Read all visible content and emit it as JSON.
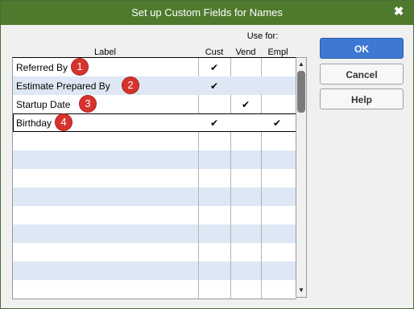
{
  "window": {
    "title": "Set up Custom Fields for Names",
    "close_glyph": "✖"
  },
  "table": {
    "use_for_label": "Use for:",
    "columns": [
      "Label",
      "Cust",
      "Vend",
      "Empl"
    ],
    "rows": [
      {
        "label": "Referred By",
        "cust": "✔",
        "vend": "",
        "empl": "",
        "badge": "1"
      },
      {
        "label": "Estimate Prepared By",
        "cust": "✔",
        "vend": "",
        "empl": "",
        "badge": "2"
      },
      {
        "label": "Startup Date",
        "cust": "",
        "vend": "✔",
        "empl": "",
        "badge": "3"
      },
      {
        "label": "Birthday",
        "cust": "✔",
        "vend": "",
        "empl": "✔",
        "badge": "4"
      }
    ]
  },
  "scrollbar": {
    "up_glyph": "▲",
    "down_glyph": "▼"
  },
  "buttons": {
    "ok": "OK",
    "cancel": "Cancel",
    "help": "Help"
  },
  "colors": {
    "titlebar": "#4f7a2e",
    "primary_button": "#3d79d3",
    "row_stripe": "#dde8f4",
    "badge": "#d6332e"
  }
}
